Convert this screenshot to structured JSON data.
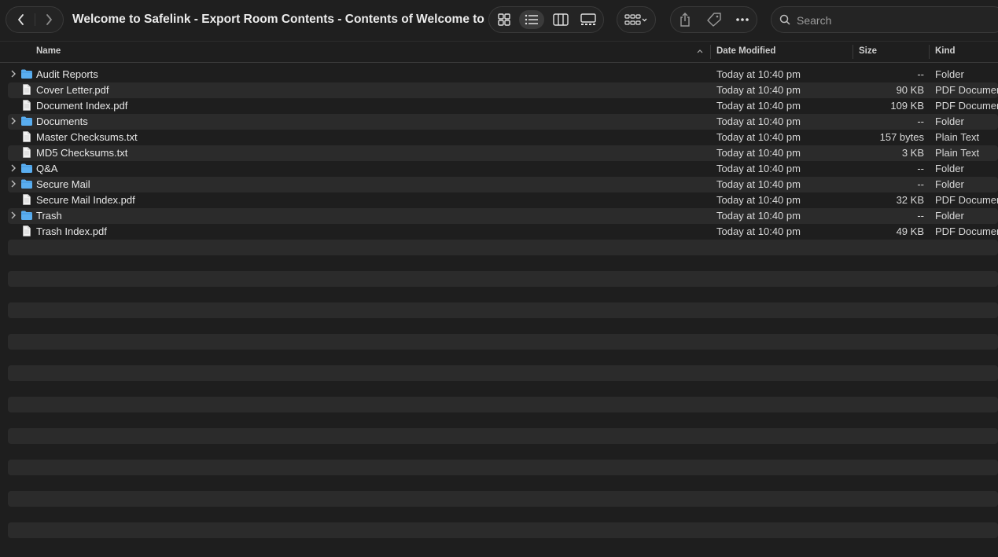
{
  "window": {
    "title": "Welcome to Safelink - Export Room Contents - Contents of Welcome to..."
  },
  "toolbar": {
    "back_icon": "chevron-left-icon",
    "forward_icon": "chevron-right-icon",
    "view_modes": [
      "icon-view",
      "list-view",
      "column-view",
      "gallery-view"
    ],
    "active_view": "list-view",
    "search_placeholder": "Search"
  },
  "columns": {
    "name": "Name",
    "date_modified": "Date Modified",
    "size": "Size",
    "kind": "Kind"
  },
  "files": [
    {
      "name": "Audit Reports",
      "type": "folder",
      "date": "Today at 10:40 pm",
      "size": "--",
      "kind": "Folder"
    },
    {
      "name": "Cover Letter.pdf",
      "type": "file",
      "date": "Today at 10:40 pm",
      "size": "90 KB",
      "kind": "PDF Document"
    },
    {
      "name": "Document Index.pdf",
      "type": "file",
      "date": "Today at 10:40 pm",
      "size": "109 KB",
      "kind": "PDF Document"
    },
    {
      "name": "Documents",
      "type": "folder",
      "date": "Today at 10:40 pm",
      "size": "--",
      "kind": "Folder"
    },
    {
      "name": "Master Checksums.txt",
      "type": "file",
      "date": "Today at 10:40 pm",
      "size": "157 bytes",
      "kind": "Plain Text"
    },
    {
      "name": "MD5 Checksums.txt",
      "type": "file",
      "date": "Today at 10:40 pm",
      "size": "3 KB",
      "kind": "Plain Text"
    },
    {
      "name": "Q&A",
      "type": "folder",
      "date": "Today at 10:40 pm",
      "size": "--",
      "kind": "Folder"
    },
    {
      "name": "Secure Mail",
      "type": "folder",
      "date": "Today at 10:40 pm",
      "size": "--",
      "kind": "Folder"
    },
    {
      "name": "Secure Mail Index.pdf",
      "type": "file",
      "date": "Today at 10:40 pm",
      "size": "32 KB",
      "kind": "PDF Document"
    },
    {
      "name": "Trash",
      "type": "folder",
      "date": "Today at 10:40 pm",
      "size": "--",
      "kind": "Folder"
    },
    {
      "name": "Trash Index.pdf",
      "type": "file",
      "date": "Today at 10:40 pm",
      "size": "49 KB",
      "kind": "PDF Document"
    }
  ],
  "colors": {
    "background": "#1e1e1e",
    "stripe": "#2b2b2b",
    "folder": "#5aaef0",
    "text": "#e8e8e8"
  }
}
